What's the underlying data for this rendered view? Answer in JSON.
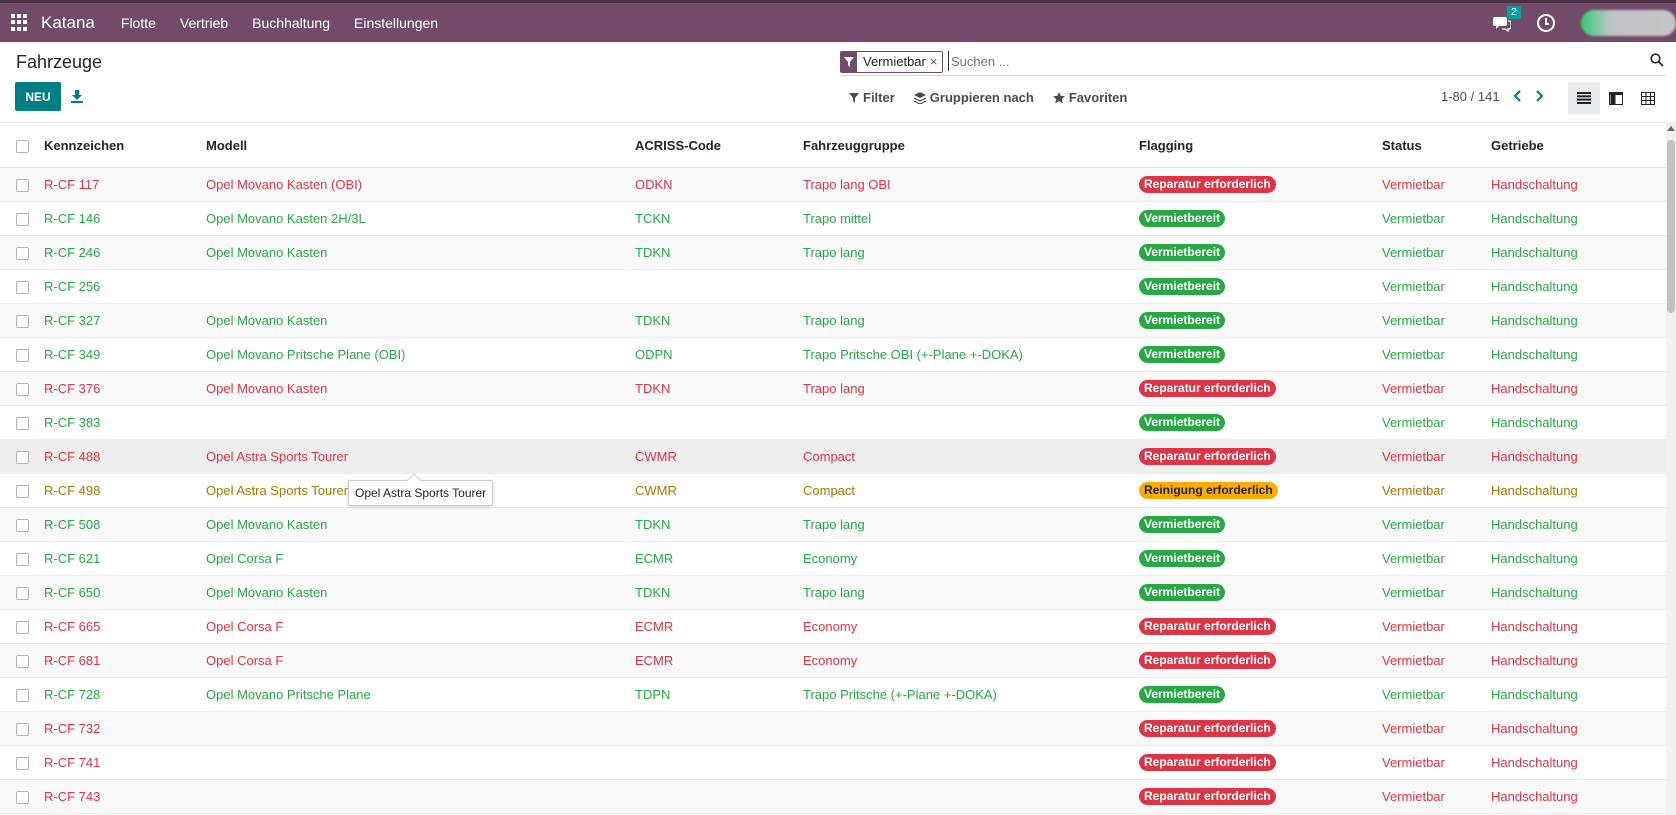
{
  "navbar": {
    "brand": "Katana",
    "menu": [
      "Flotte",
      "Vertrieb",
      "Buchhaltung",
      "Einstellungen"
    ],
    "messages_count": "2"
  },
  "control": {
    "title": "Fahrzeuge",
    "new_label": "NEU",
    "facet_label": "Vermietbar",
    "facet_close": "×",
    "search_placeholder": "Suchen ...",
    "filter_label": "Filter",
    "group_label": "Gruppieren nach",
    "favorites_label": "Favoriten",
    "pager": "1-80 / 141"
  },
  "table": {
    "headers": [
      "Kennzeichen",
      "Modell",
      "ACRISS-Code",
      "Fahrzeuggruppe",
      "Flagging",
      "Status",
      "Getriebe"
    ],
    "rows": [
      {
        "plate": "R-CF 117",
        "model": "Opel Movano Kasten (OBI)",
        "acriss": "ODKN",
        "group": "Trapo lang OBI",
        "flag": "Reparatur erforderlich",
        "status": "Vermietbar",
        "gear": "Handschaltung",
        "color": "red"
      },
      {
        "plate": "R-CF 146",
        "model": "Opel Movano Kasten 2H/3L",
        "acriss": "TCKN",
        "group": "Trapo mittel",
        "flag": "Vermietbereit",
        "status": "Vermietbar",
        "gear": "Handschaltung",
        "color": "green"
      },
      {
        "plate": "R-CF 246",
        "model": "Opel Movano Kasten",
        "acriss": "TDKN",
        "group": "Trapo lang",
        "flag": "Vermietbereit",
        "status": "Vermietbar",
        "gear": "Handschaltung",
        "color": "green"
      },
      {
        "plate": "R-CF 256",
        "model": "",
        "acriss": "",
        "group": "",
        "flag": "Vermietbereit",
        "status": "Vermietbar",
        "gear": "Handschaltung",
        "color": "green"
      },
      {
        "plate": "R-CF 327",
        "model": "Opel Movano Kasten",
        "acriss": "TDKN",
        "group": "Trapo lang",
        "flag": "Vermietbereit",
        "status": "Vermietbar",
        "gear": "Handschaltung",
        "color": "green"
      },
      {
        "plate": "R-CF 349",
        "model": "Opel Movano Pritsche Plane (OBI)",
        "acriss": "ODPN",
        "group": "Trapo Pritsche OBI (+-Plane +-DOKA)",
        "flag": "Vermietbereit",
        "status": "Vermietbar",
        "gear": "Handschaltung",
        "color": "green"
      },
      {
        "plate": "R-CF 376",
        "model": "Opel Movano Kasten",
        "acriss": "TDKN",
        "group": "Trapo lang",
        "flag": "Reparatur erforderlich",
        "status": "Vermietbar",
        "gear": "Handschaltung",
        "color": "red"
      },
      {
        "plate": "R-CF 383",
        "model": "",
        "acriss": "",
        "group": "",
        "flag": "Vermietbereit",
        "status": "Vermietbar",
        "gear": "Handschaltung",
        "color": "green"
      },
      {
        "plate": "R-CF 488",
        "model": "Opel Astra Sports Tourer",
        "acriss": "CWMR",
        "group": "Compact",
        "flag": "Reparatur erforderlich",
        "status": "Vermietbar",
        "gear": "Handschaltung",
        "color": "red"
      },
      {
        "plate": "R-CF 498",
        "model": "Opel Astra Sports Tourer",
        "acriss": "CWMR",
        "group": "Compact",
        "flag": "Reinigung erforderlich",
        "status": "Vermietbar",
        "gear": "Handschaltung",
        "color": "yellow"
      },
      {
        "plate": "R-CF 508",
        "model": "Opel Movano Kasten",
        "acriss": "TDKN",
        "group": "Trapo lang",
        "flag": "Vermietbereit",
        "status": "Vermietbar",
        "gear": "Handschaltung",
        "color": "green"
      },
      {
        "plate": "R-CF 621",
        "model": "Opel Corsa F",
        "acriss": "ECMR",
        "group": "Economy",
        "flag": "Vermietbereit",
        "status": "Vermietbar",
        "gear": "Handschaltung",
        "color": "green"
      },
      {
        "plate": "R-CF 650",
        "model": "Opel Movano Kasten",
        "acriss": "TDKN",
        "group": "Trapo lang",
        "flag": "Vermietbereit",
        "status": "Vermietbar",
        "gear": "Handschaltung",
        "color": "green"
      },
      {
        "plate": "R-CF 665",
        "model": "Opel Corsa F",
        "acriss": "ECMR",
        "group": "Economy",
        "flag": "Reparatur erforderlich",
        "status": "Vermietbar",
        "gear": "Handschaltung",
        "color": "red"
      },
      {
        "plate": "R-CF 681",
        "model": "Opel Corsa F",
        "acriss": "ECMR",
        "group": "Economy",
        "flag": "Reparatur erforderlich",
        "status": "Vermietbar",
        "gear": "Handschaltung",
        "color": "red"
      },
      {
        "plate": "R-CF 728",
        "model": "Opel Movano Pritsche Plane",
        "acriss": "TDPN",
        "group": "Trapo Pritsche (+-Plane +-DOKA)",
        "flag": "Vermietbereit",
        "status": "Vermietbar",
        "gear": "Handschaltung",
        "color": "green"
      },
      {
        "plate": "R-CF 732",
        "model": "",
        "acriss": "",
        "group": "",
        "flag": "Reparatur erforderlich",
        "status": "Vermietbar",
        "gear": "Handschaltung",
        "color": "red"
      },
      {
        "plate": "R-CF 741",
        "model": "",
        "acriss": "",
        "group": "",
        "flag": "Reparatur erforderlich",
        "status": "Vermietbar",
        "gear": "Handschaltung",
        "color": "red"
      },
      {
        "plate": "R-CF 743",
        "model": "",
        "acriss": "",
        "group": "",
        "flag": "Reparatur erforderlich",
        "status": "Vermietbar",
        "gear": "Handschaltung",
        "color": "red"
      }
    ]
  },
  "tooltip": "Opel Astra Sports Tourer",
  "colors": {
    "navbar": "#714b67",
    "primary": "#017e84",
    "green": "#28a745",
    "red": "#dc3545",
    "yellow": "#ffac00"
  }
}
